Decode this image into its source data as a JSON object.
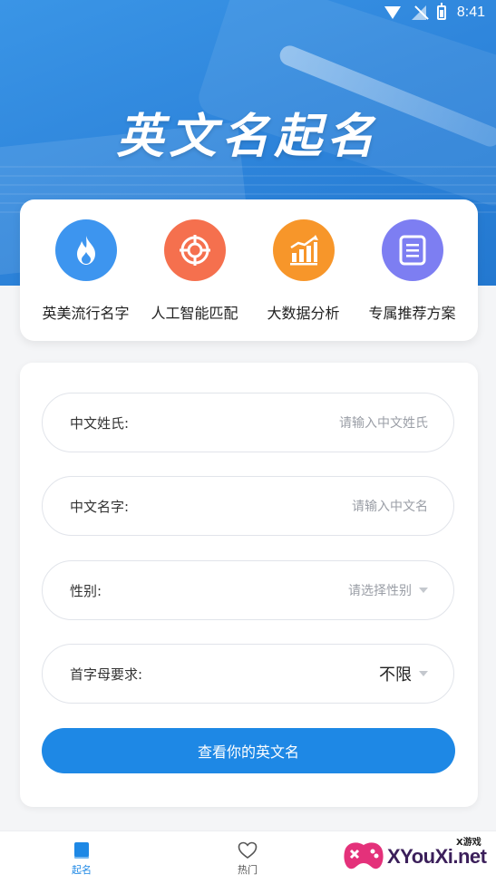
{
  "status_bar": {
    "time": "8:41"
  },
  "header": {
    "title": "英文名起名"
  },
  "features": [
    {
      "label": "英美流行名字",
      "icon": "flame-icon",
      "color": "#3d95ef"
    },
    {
      "label": "人工智能匹配",
      "icon": "target-icon",
      "color": "#f5704e"
    },
    {
      "label": "大数据分析",
      "icon": "chart-icon",
      "color": "#f7962a"
    },
    {
      "label": "专属推荐方案",
      "icon": "document-icon",
      "color": "#7d7ef2"
    }
  ],
  "form": {
    "surname": {
      "label": "中文姓氏:",
      "placeholder": "请输入中文姓氏"
    },
    "given_name": {
      "label": "中文名字:",
      "placeholder": "请输入中文名"
    },
    "gender": {
      "label": "性别:",
      "placeholder": "请选择性别"
    },
    "initial": {
      "label": "首字母要求:",
      "value": "不限"
    },
    "submit_label": "查看你的英文名"
  },
  "bottom_nav": [
    {
      "label": "起名",
      "icon": "book-icon",
      "active": true
    },
    {
      "label": "热门",
      "icon": "heart-icon",
      "active": false
    }
  ],
  "watermark": {
    "brand": "XYouXi.net",
    "small": "X游戏"
  },
  "colors": {
    "primary": "#1e88e5",
    "banner": "#2f86dc"
  }
}
